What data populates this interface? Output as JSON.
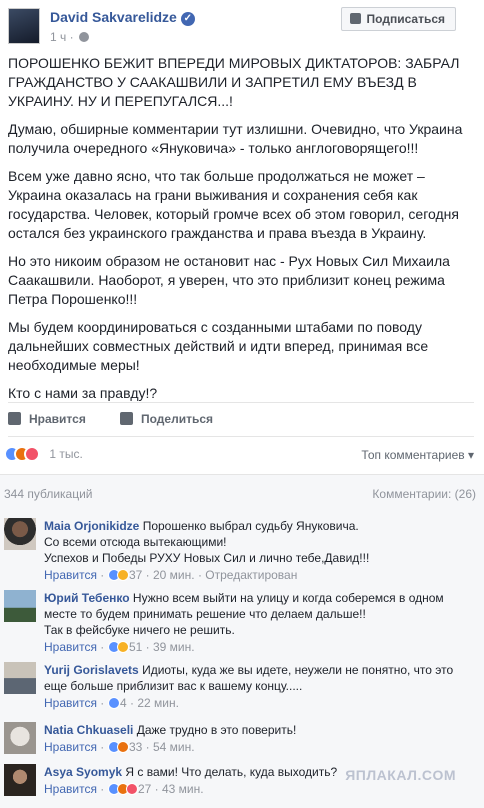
{
  "header": {
    "author": "David Sakvarelidze",
    "time": "1 ч",
    "subscribe_label": "Подписаться"
  },
  "post": {
    "paragraphs": [
      "ПОРОШЕНКО БЕЖИТ ВПЕРЕДИ МИРОВЫХ ДИКТАТОРОВ: ЗАБРАЛ ГРАЖДАНСТВО У СААКАШВИЛИ И ЗАПРЕТИЛ ЕМУ ВЪЕЗД В УКРАИНУ. НУ И ПЕРЕПУГАЛСЯ...!",
      "Думаю, обширные комментарии тут излишни. Очевидно, что Украина получила очередного «Януковича» - только англоговорящего!!!",
      "Всем уже давно ясно, что так больше продолжаться не может – Украина оказалась на грани выживания и сохранения себя как государства. Человек, который громче всех об этом говорил, сегодня остался без украинского гражданства и права въезда в Украину.",
      "Но это никоим образом не остановит нас - Рух Новых Сил Михаила Саакашвили. Наоборот, я уверен, что это приблизит конец режима Петра Порошенко!!!",
      "Мы будем координироваться с созданными штабами по поводу дальнейших совместных действий и идти вперед, принимая все необходимые меры!",
      "Кто с нами за правду!?"
    ]
  },
  "actions": {
    "like_label": "Нравится",
    "share_label": "Поделиться"
  },
  "reactions": {
    "count": "1 тыс.",
    "top_comments_label": "Топ комментариев ▾"
  },
  "comments_bar": {
    "shares": "344 публикаций",
    "comments": "Комментарии: (26)"
  },
  "comments": [
    {
      "name": "Maia Orjonikidze",
      "lines": [
        "Порошенко выбрал судьбу Януковича.",
        "Со всеми отсюда вытекающими!",
        "Успехов и Победы РУХУ Новых Сил и лично тебе,Давид!!!"
      ],
      "like": "Нравится",
      "count": "37",
      "time": "20 мин.",
      "extra": "Отредактирован"
    },
    {
      "name": "Юрий Тебенко",
      "lines": [
        "Нужно всем выйти на улицу и когда соберемся в одном",
        "месте то будем принимать решение что делаем дальше!!",
        "Так в фейсбуке ничего не решить."
      ],
      "like": "Нравится",
      "count": "51",
      "time": "39 мин.",
      "extra": ""
    },
    {
      "name": "Yurij Gorislavets",
      "lines": [
        "Идиоты, куда же вы идете, неужели не понятно, что это",
        "еще больше приблизит вас к вашему концу....."
      ],
      "like": "Нравится",
      "count": "4",
      "time": "22 мин.",
      "extra": ""
    },
    {
      "name": "Natia Chkuaseli",
      "lines": [
        "Даже трудно в это поверить!"
      ],
      "like": "Нравится",
      "count": "33",
      "time": "54 мин.",
      "extra": ""
    },
    {
      "name": "Asya Syomyk",
      "lines": [
        "Я с вами! Что делать, куда выходить?"
      ],
      "like": "Нравится",
      "count": "27",
      "time": "43 мин.",
      "extra": ""
    }
  ],
  "watermark": "ЯПЛАКАЛ.COM",
  "colors": {
    "link": "#365899",
    "muted": "#90949c",
    "like": "#5890ff"
  }
}
